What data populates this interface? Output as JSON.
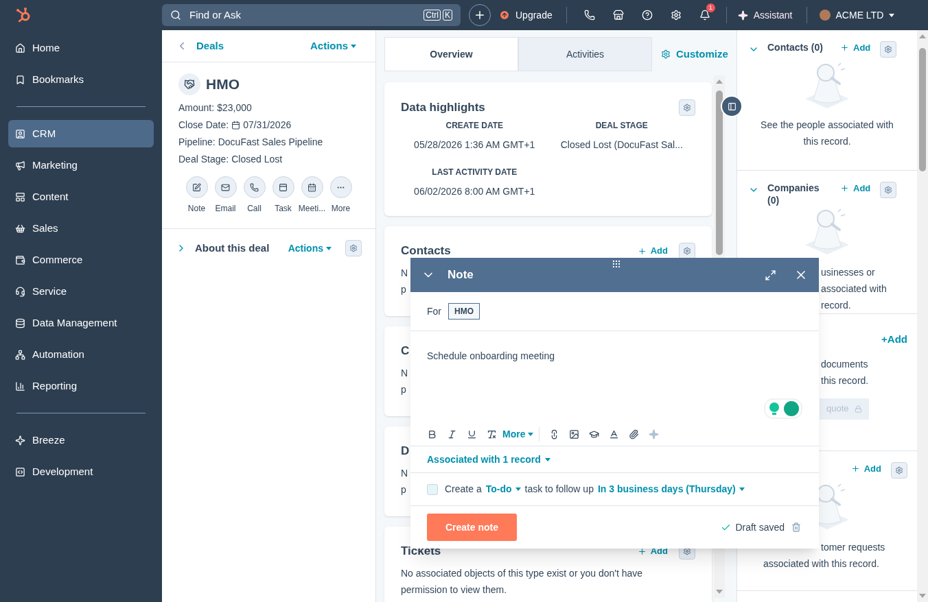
{
  "topbar": {
    "search": {
      "placeholder": "Find or Ask",
      "keys": [
        "Ctrl",
        "K"
      ]
    },
    "upgrade": "Upgrade",
    "notifications": "1",
    "assistant": "Assistant",
    "account": "ACME LTD"
  },
  "sidebar": {
    "sections": [
      [
        {
          "label": "Home",
          "selected": false
        },
        {
          "label": "Bookmarks",
          "selected": false
        }
      ],
      [
        {
          "label": "CRM",
          "selected": true
        },
        {
          "label": "Marketing",
          "selected": false
        },
        {
          "label": "Content",
          "selected": false
        },
        {
          "label": "Sales",
          "selected": false
        },
        {
          "label": "Commerce",
          "selected": false
        },
        {
          "label": "Service",
          "selected": false
        },
        {
          "label": "Data Management",
          "selected": false
        },
        {
          "label": "Automation",
          "selected": false
        },
        {
          "label": "Reporting",
          "selected": false
        }
      ],
      [
        {
          "label": "Breeze",
          "selected": false
        },
        {
          "label": "Development",
          "selected": false
        }
      ]
    ]
  },
  "record": {
    "back": "Deals",
    "actions": "Actions",
    "title": "HMO",
    "fields": [
      {
        "label": "Amount:",
        "value": "$23,000",
        "kind": "text"
      },
      {
        "label": "Close Date:",
        "value": "07/31/2026",
        "kind": "date"
      },
      {
        "label": "Pipeline:",
        "value": "DocuFast Sales Pipeline",
        "kind": "text"
      },
      {
        "label": "Deal Stage:",
        "value": "Closed Lost",
        "kind": "text"
      }
    ],
    "quick_actions": [
      "Note",
      "Email",
      "Call",
      "Task",
      "Meeti...",
      "More"
    ],
    "about": {
      "title": "About this deal",
      "actions": "Actions",
      "expanded": false
    }
  },
  "middle": {
    "tabs": [
      {
        "label": "Overview",
        "selected": true
      },
      {
        "label": "Activities",
        "selected": false
      }
    ],
    "customize": "Customize",
    "highlights": {
      "title": "Data highlights",
      "items": [
        {
          "label": "CREATE DATE",
          "value": "05/28/2026 1:36 AM GMT+1"
        },
        {
          "label": "DEAL STAGE",
          "value": "Closed Lost (DocuFast Sal..."
        },
        {
          "label": "LAST ACTIVITY DATE",
          "value": "06/02/2026 8:00 AM GMT+1"
        }
      ]
    },
    "cards": [
      {
        "title": "Contacts",
        "add": "Add",
        "lines": [
          "N",
          "p"
        ]
      },
      {
        "title": "C",
        "lines": [
          "N",
          "p"
        ]
      },
      {
        "title": "D",
        "lines": [
          "N",
          "p"
        ]
      },
      {
        "title": "Tickets",
        "add": "Add",
        "lines": [
          "No associated objects of this type exist or you don't have",
          "permission to view them."
        ]
      }
    ]
  },
  "right": {
    "sections": [
      {
        "title": "Contacts (0)",
        "add": "Add",
        "expanded": true,
        "partial": false,
        "lines": [
          "See the people associated with",
          "this record."
        ]
      },
      {
        "title": "Companies (0)",
        "add": "Add",
        "expanded": true,
        "partial": true,
        "lines": [
          "usinesses or",
          "associated with",
          "record."
        ]
      },
      {
        "link": "+Add",
        "partial": true,
        "lines": [
          "documents",
          "this record."
        ],
        "button": "quote"
      },
      {
        "add": "Add",
        "partial": true,
        "lines": [
          "tomer requests",
          "associated with this record."
        ]
      }
    ]
  },
  "note": {
    "title": "Note",
    "for_label": "For",
    "tag": "HMO",
    "body": "Schedule onboarding meeting",
    "more": "More",
    "associated": "Associated with 1 record",
    "task": {
      "checked": false,
      "parts": [
        {
          "text": "Create a",
          "kind": "plain"
        },
        {
          "text": "To-do",
          "kind": "link"
        },
        {
          "text": "task to follow up",
          "kind": "plain"
        },
        {
          "text": "In 3 business days (Thursday)",
          "kind": "link"
        }
      ]
    },
    "submit": "Create note",
    "status": "Draft saved"
  }
}
